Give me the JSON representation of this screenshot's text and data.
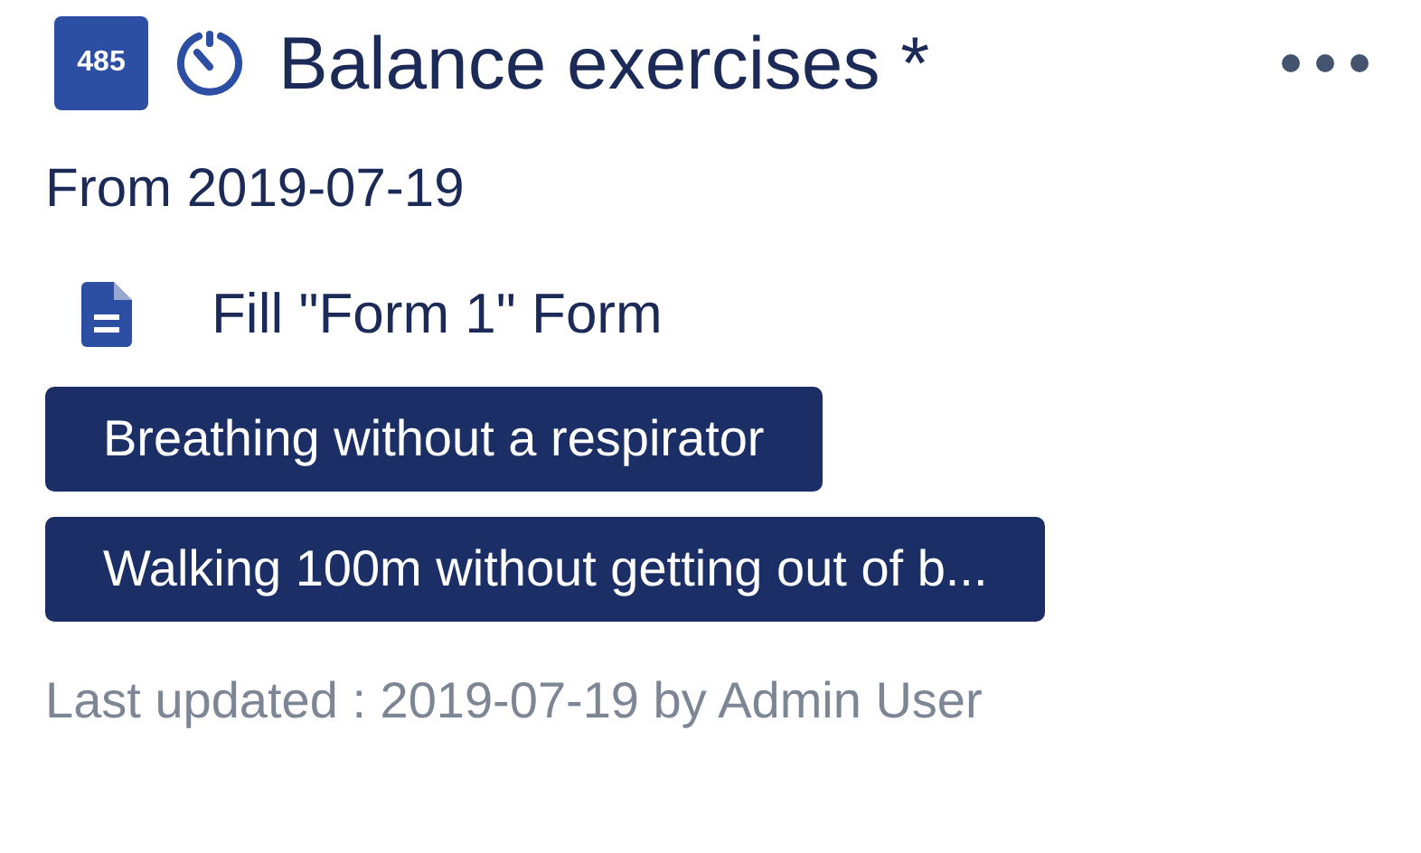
{
  "badge": "485",
  "title": "Balance exercises *",
  "date_range": "From 2019-07-19",
  "tasks": [
    {
      "kind": "form",
      "label": "Fill \"Form 1\" Form"
    }
  ],
  "tags": [
    "Breathing without a respirator",
    "Walking 100m without getting out of b..."
  ],
  "footer": "Last updated : 2019-07-19 by Admin User"
}
